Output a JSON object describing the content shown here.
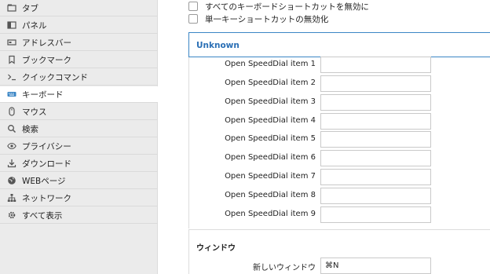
{
  "sidebar": {
    "items": [
      {
        "label": "タブ",
        "icon": "tab-icon"
      },
      {
        "label": "パネル",
        "icon": "panel-icon"
      },
      {
        "label": "アドレスバー",
        "icon": "address-bar-icon"
      },
      {
        "label": "ブックマーク",
        "icon": "bookmark-icon"
      },
      {
        "label": "クイックコマンド",
        "icon": "quick-command-icon"
      },
      {
        "label": "キーボード",
        "icon": "keyboard-icon",
        "active": true
      },
      {
        "label": "マウス",
        "icon": "mouse-icon"
      },
      {
        "label": "検索",
        "icon": "search-icon"
      },
      {
        "label": "プライバシー",
        "icon": "privacy-eye-icon"
      },
      {
        "label": "ダウンロード",
        "icon": "download-icon"
      },
      {
        "label": "WEBページ",
        "icon": "globe-icon"
      },
      {
        "label": "ネットワーク",
        "icon": "network-icon"
      },
      {
        "label": "すべて表示",
        "icon": "gear-icon"
      }
    ]
  },
  "options": {
    "disable_all_shortcuts": "すべてのキーボードショートカットを無効に",
    "disable_single_key": "単一キーショートカットの無効化"
  },
  "unknown_section": {
    "title": "Unknown",
    "rows": [
      {
        "label": "Open SpeedDial item 1",
        "value": ""
      },
      {
        "label": "Open SpeedDial item 2",
        "value": ""
      },
      {
        "label": "Open SpeedDial item 3",
        "value": ""
      },
      {
        "label": "Open SpeedDial item 4",
        "value": ""
      },
      {
        "label": "Open SpeedDial item 5",
        "value": ""
      },
      {
        "label": "Open SpeedDial item 6",
        "value": ""
      },
      {
        "label": "Open SpeedDial item 7",
        "value": ""
      },
      {
        "label": "Open SpeedDial item 8",
        "value": ""
      },
      {
        "label": "Open SpeedDial item 9",
        "value": ""
      }
    ]
  },
  "window_section": {
    "title": "ウィンドウ",
    "rows": [
      {
        "label": "新しいウィンドウ",
        "value": "⌘N"
      }
    ]
  }
}
